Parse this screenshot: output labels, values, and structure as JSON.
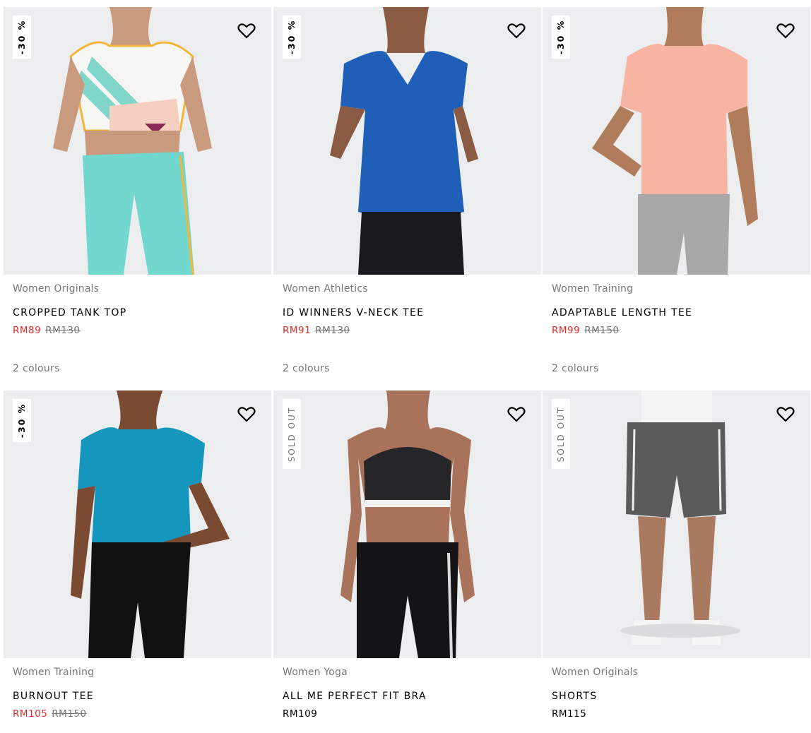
{
  "products": [
    {
      "category": "Women Originals",
      "name": "CROPPED TANK TOP",
      "sale_price": "RM89",
      "original_price": "RM130",
      "badge": "-30 %",
      "colours": "2 colours",
      "image_icon": "cropped-tank-top-photo"
    },
    {
      "category": "Women Athletics",
      "name": "ID WINNERS V-NECK TEE",
      "sale_price": "RM91",
      "original_price": "RM130",
      "badge": "-30 %",
      "colours": "2 colours",
      "image_icon": "v-neck-tee-photo"
    },
    {
      "category": "Women Training",
      "name": "ADAPTABLE LENGTH TEE",
      "sale_price": "RM99",
      "original_price": "RM150",
      "badge": "-30 %",
      "colours": "2 colours",
      "image_icon": "length-tee-photo"
    },
    {
      "category": "Women Training",
      "name": "BURNOUT TEE",
      "sale_price": "RM105",
      "original_price": "RM150",
      "badge": "-30 %",
      "image_icon": "burnout-tee-photo"
    },
    {
      "category": "Women Yoga",
      "name": "ALL ME PERFECT FIT BRA",
      "price": "RM109",
      "badge": "SOLD OUT",
      "image_icon": "sports-bra-photo"
    },
    {
      "category": "Women Originals",
      "name": "SHORTS",
      "price": "RM115",
      "badge": "SOLD OUT",
      "image_icon": "shorts-photo"
    }
  ],
  "colors": {
    "sale": "#e32b2b",
    "muted": "#767677",
    "image_bg": "#ebedee"
  }
}
